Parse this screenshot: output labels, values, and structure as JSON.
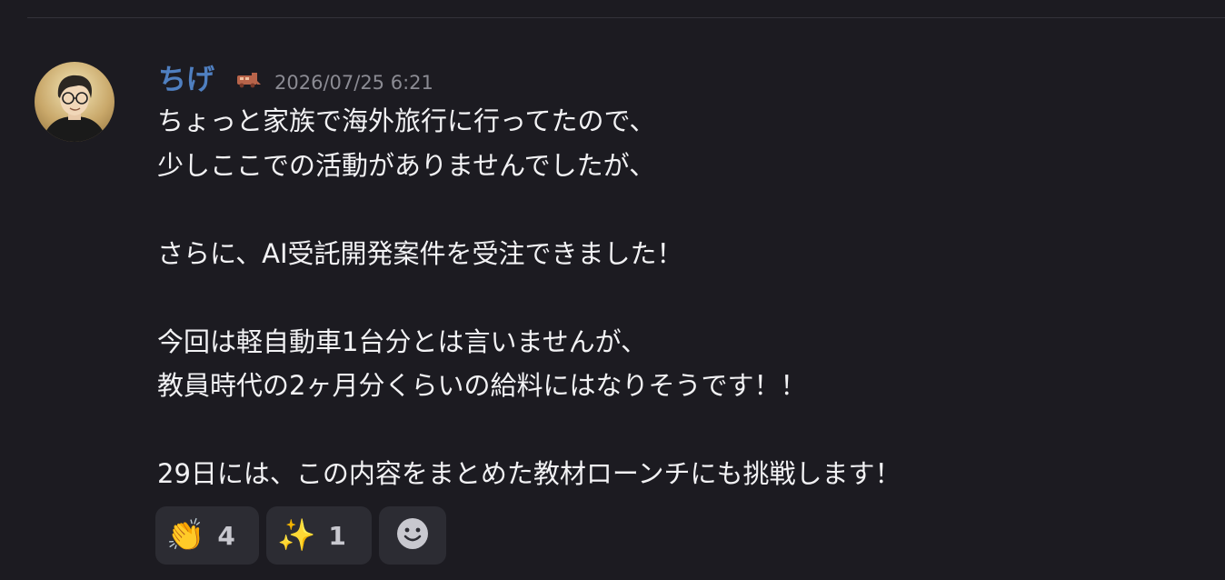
{
  "message": {
    "author": "ちげ",
    "role_icon": "train-icon",
    "timestamp": "2026/07/25 6:21",
    "lines": [
      "ちょっと家族で海外旅行に行ってたので、",
      "少しここでの活動がありませんでしたが、",
      "",
      "さらに、AI受託開発案件を受注できました！",
      "",
      "今回は軽自動車1台分とは言いませんが、",
      "教員時代の2ヶ月分くらいの給料にはなりそうです！！",
      "",
      "29日には、この内容をまとめた教材ローンチにも挑戦します！"
    ]
  },
  "reactions": [
    {
      "emoji": "👏",
      "icon": "clapping-hands-icon",
      "count": "4"
    },
    {
      "emoji": "✨",
      "icon": "sparkles-icon",
      "count": "1"
    }
  ],
  "add_reaction_icon": "smiley-face-icon",
  "colors": {
    "background": "#1c1b21",
    "username": "#4f7fc0",
    "timestamp": "#8b8b93",
    "reaction_bg": "#2c2c33"
  }
}
